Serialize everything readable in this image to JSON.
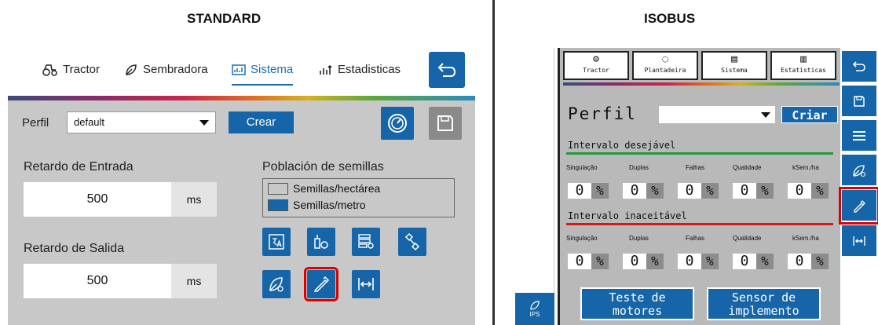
{
  "labels": {
    "standard": "STANDARD",
    "isobus": "ISOBUS"
  },
  "standard": {
    "tabs": [
      {
        "label": "Tractor",
        "icon": "tractor-icon"
      },
      {
        "label": "Sembradora",
        "icon": "seed-icon"
      },
      {
        "label": "Sistema",
        "icon": "system-icon",
        "active": true
      },
      {
        "label": "Estadisticas",
        "icon": "stats-icon"
      }
    ],
    "perfil_label": "Perfil",
    "perfil_value": "default",
    "crear_label": "Crear",
    "retardo_entrada_label": "Retardo de Entrada",
    "retardo_entrada_value": "500",
    "retardo_entrada_unit": "ms",
    "retardo_salida_label": "Retardo de Salida",
    "retardo_salida_value": "500",
    "retardo_salida_unit": "ms",
    "poblacion_label": "Población de semillas",
    "poblacion_options": [
      "Semillas/hectárea",
      "Semillas/metro"
    ],
    "poblacion_selected": "Semillas/metro"
  },
  "isobus": {
    "tabs": [
      "Tractor",
      "Plantadeira",
      "Sistema",
      "Estatísticas"
    ],
    "perfil_label": "Perfil",
    "criar_label": "Criar",
    "desejavel_label": "Intervalo desejável",
    "inaceitavel_label": "Intervalo inaceitável",
    "columns": [
      "Singulação",
      "Duplas",
      "Falhas",
      "Qualidade",
      "kSem./ha"
    ],
    "desejavel_values": [
      "0",
      "0",
      "0",
      "0",
      "0"
    ],
    "inaceitavel_values": [
      "0",
      "0",
      "0",
      "0",
      "0"
    ],
    "percent": "%",
    "teste_motores_label": "Teste de motores",
    "sensor_implemento_label": "Sensor de implemento",
    "ips_label": "IPS"
  },
  "colors": {
    "accent": "#1565a8",
    "highlight": "#e00000",
    "panel": "#c8c8c8"
  }
}
